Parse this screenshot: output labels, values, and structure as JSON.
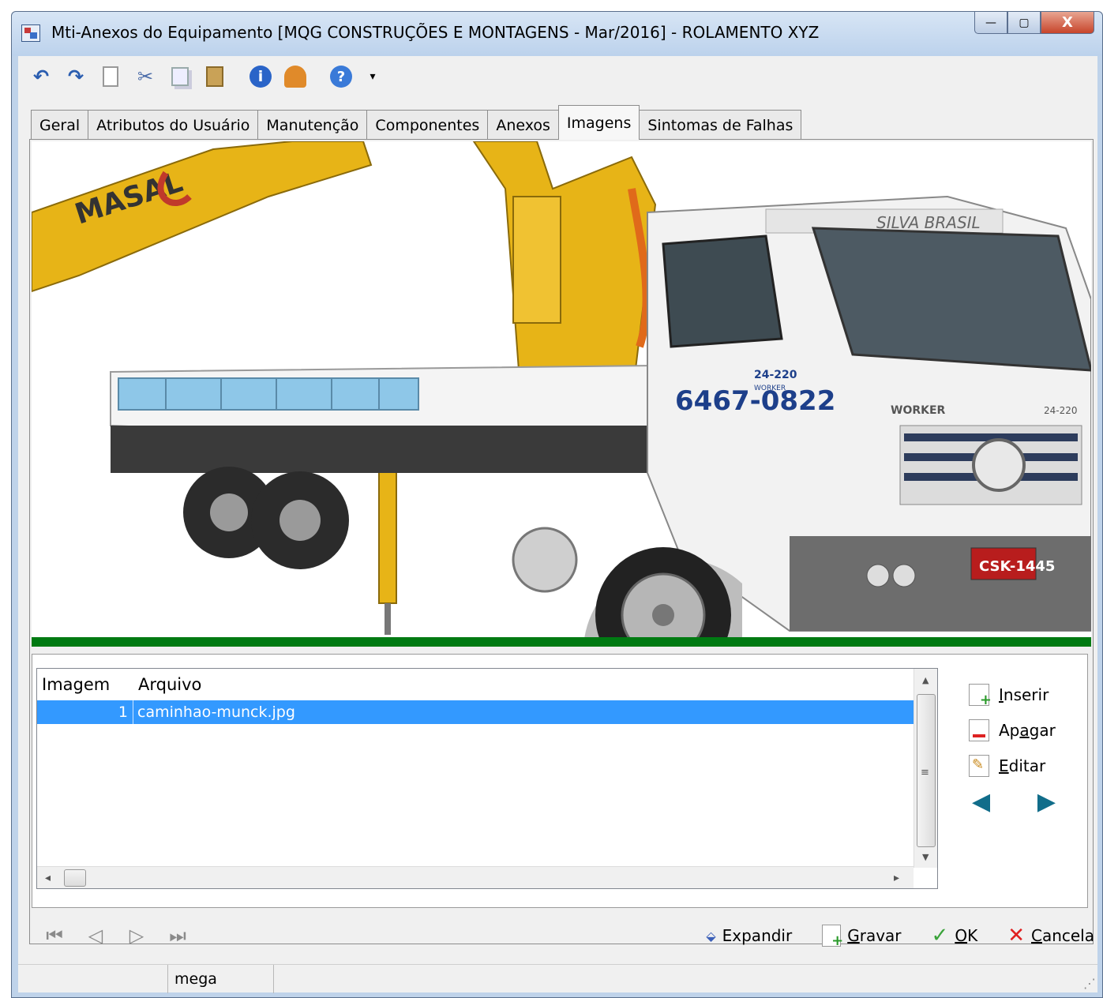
{
  "window": {
    "title": "Mti-Anexos do Equipamento [MQG CONSTRUÇÕES E MONTAGENS - Mar/2016]  - ROLAMENTO XYZ",
    "controls": {
      "minimize": "—",
      "maximize": "▢",
      "close": "X"
    }
  },
  "toolbar": {
    "icons": [
      "undo-icon",
      "redo-icon",
      "new-icon",
      "cut-icon",
      "copy-icon",
      "paste-icon",
      "info-icon",
      "user-icon",
      "help-icon"
    ],
    "glyphs": {
      "undo": "↶",
      "redo": "↷",
      "cut": "✂",
      "info": "i",
      "help": "?",
      "caret": "▾"
    }
  },
  "tabs": [
    {
      "label": "Geral",
      "active": false
    },
    {
      "label": "Atributos do Usuário",
      "active": false
    },
    {
      "label": "Manutenção",
      "active": false
    },
    {
      "label": "Componentes",
      "active": false
    },
    {
      "label": "Anexos",
      "active": false
    },
    {
      "label": "Imagens",
      "active": true
    },
    {
      "label": "Sintomas de Falhas",
      "active": false
    }
  ],
  "photo": {
    "subject": "truck-crane",
    "boom_text": "MASAL",
    "cab_header": "SILVA BRASIL",
    "door_phone": "6467-0822",
    "door_model": "24-220",
    "door_sub": "WORKER",
    "grille_text": "WORKER",
    "grille_model": "24-220",
    "plate": "CSK-1445",
    "accent_yellow": "#e7b417",
    "accent_green": "#007a12"
  },
  "grid": {
    "headers": {
      "image": "Imagem",
      "file": "Arquivo"
    },
    "rows": [
      {
        "index": "1",
        "file": "caminhao-munck.jpg",
        "selected": true
      }
    ],
    "selection_color": "#3399ff",
    "scroll": {
      "up": "▲",
      "down": "▼",
      "left": "◂",
      "right": "▸",
      "grip": "≡"
    }
  },
  "side_buttons": {
    "insert_first": "I",
    "insert_rest": "nserir",
    "delete_first": "Ap",
    "delete_under": "a",
    "delete_rest": "gar",
    "edit_first": "E",
    "edit_rest": "ditar",
    "prev": "◀",
    "next": "▶"
  },
  "navigation": {
    "first": "⏮",
    "prev": "◁",
    "next": "▷",
    "last": "⏭"
  },
  "actions": {
    "expand": "Expandir",
    "save_first": "G",
    "save_rest": "ravar",
    "ok_first": "O",
    "ok_rest": "K",
    "cancel_first": "C",
    "cancel_rest": "ancela",
    "glyphs": {
      "expand": "⬙",
      "ok": "✓",
      "cancel": "✕"
    }
  },
  "statusbar": {
    "panel1": "",
    "panel2": "mega",
    "panel3": ""
  }
}
